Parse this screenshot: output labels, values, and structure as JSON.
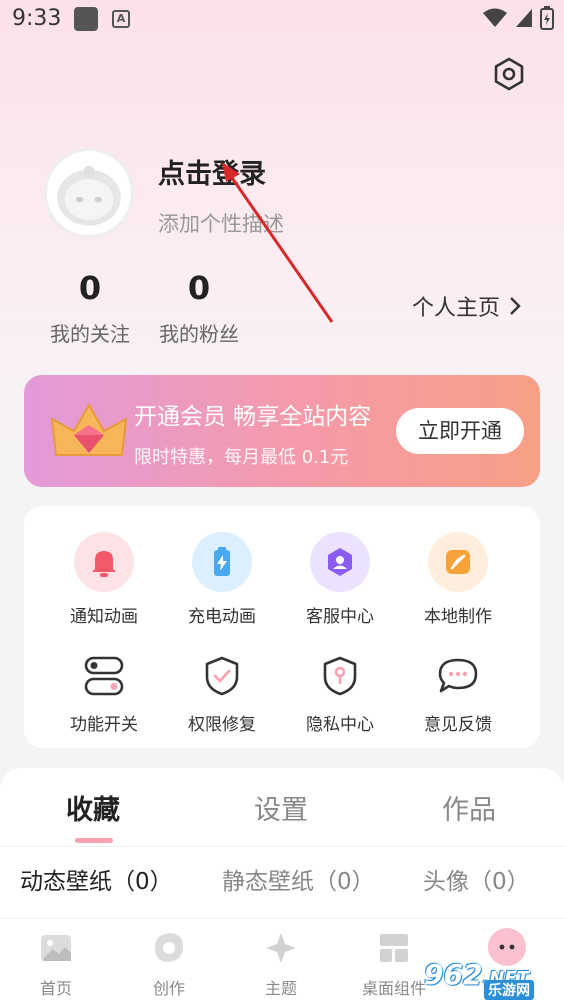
{
  "status_bar": {
    "time": "9:33"
  },
  "profile": {
    "login_title": "点击登录",
    "bio_placeholder": "添加个性描述",
    "following_count": "0",
    "following_label": "我的关注",
    "followers_count": "0",
    "followers_label": "我的粉丝",
    "homepage_link": "个人主页"
  },
  "vip_banner": {
    "title": "开通会员 畅享全站内容",
    "subtitle": "限时特惠，每月最低 0.1元",
    "button": "立即开通"
  },
  "features": [
    {
      "label": "通知动画",
      "icon": "bell-icon",
      "color": "#f25a6a"
    },
    {
      "label": "充电动画",
      "icon": "battery-icon",
      "color": "#4aa8f0"
    },
    {
      "label": "客服中心",
      "icon": "support-icon",
      "color": "#8a5cf0"
    },
    {
      "label": "本地制作",
      "icon": "pen-icon",
      "color": "#f7a23a"
    },
    {
      "label": "功能开关",
      "icon": "toggle-icon"
    },
    {
      "label": "权限修复",
      "icon": "shield-check-icon"
    },
    {
      "label": "隐私中心",
      "icon": "lock-shield-icon"
    },
    {
      "label": "意见反馈",
      "icon": "chat-icon"
    }
  ],
  "tabs": [
    {
      "label": "收藏",
      "active": true
    },
    {
      "label": "设置",
      "active": false
    },
    {
      "label": "作品",
      "active": false
    }
  ],
  "subtabs": [
    {
      "label": "动态壁纸（0）",
      "active": true
    },
    {
      "label": "静态壁纸（0）",
      "active": false
    },
    {
      "label": "头像（0）",
      "active": false
    }
  ],
  "bottom_nav": [
    {
      "label": "首页",
      "icon": "mountain-icon"
    },
    {
      "label": "创作",
      "icon": "create-icon"
    },
    {
      "label": "主题",
      "icon": "sparkle-icon"
    },
    {
      "label": "桌面组件",
      "icon": "widget-icon"
    }
  ],
  "watermark": {
    "text": "962",
    "suffix": ".NET",
    "sub": "乐游网"
  },
  "colors": {
    "accent_pink": "#f7a3b1",
    "vip_gradient_start": "#e29ad9",
    "vip_gradient_end": "#f7a086"
  }
}
